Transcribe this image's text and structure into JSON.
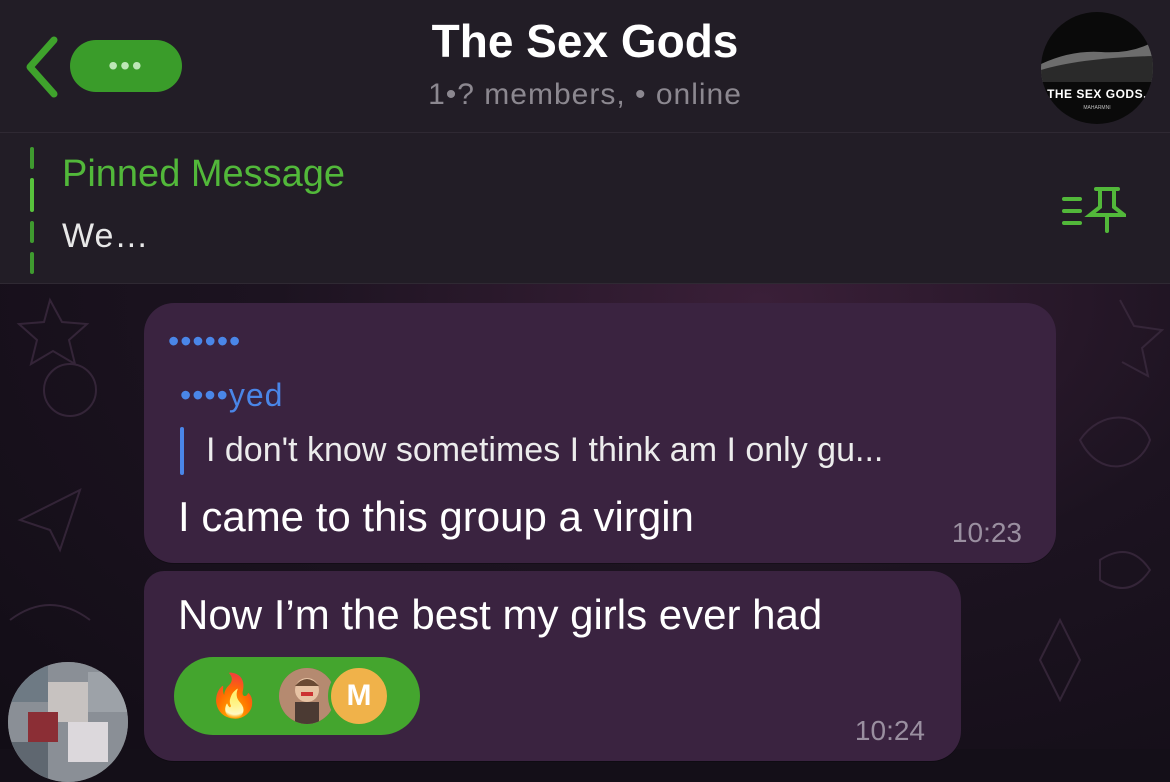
{
  "header": {
    "back_badge": "•••",
    "title": "The Sex Gods",
    "subtitle": "1•? members, • online",
    "avatar_text": "THE SEX GODS.",
    "avatar_subtext": "MAHARMNI"
  },
  "pinned": {
    "label": "Pinned Message",
    "text": "We…"
  },
  "messages": [
    {
      "sender": "••••••",
      "reply_author": "••••yed",
      "reply_text": "I don't know sometimes I think am I only gu...",
      "text": "I came to this group a virgin",
      "time": "10:23"
    },
    {
      "text": "Now I’m the best my girls ever had",
      "time": "10:24",
      "reactions": {
        "emoji": "🔥",
        "avatar_letter": "M"
      }
    }
  ],
  "colors": {
    "accent_green": "#52b83a",
    "reply_blue": "#4a86e8",
    "bubble": "#3a2340",
    "header_bg": "#221d26"
  }
}
